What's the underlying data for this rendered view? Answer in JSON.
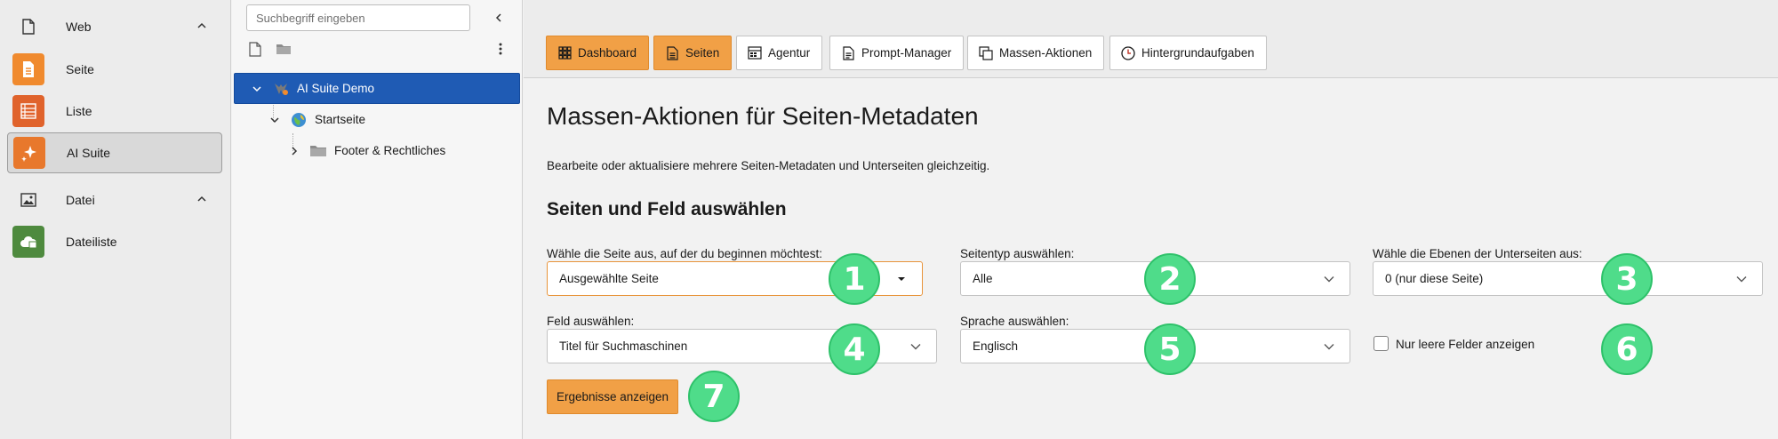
{
  "module_menu": {
    "groups": [
      {
        "label": "Web",
        "icon": "page-outline-icon"
      },
      {
        "label": "Datei",
        "icon": "image-icon"
      }
    ],
    "items": [
      {
        "label": "Seite",
        "icon": "page-module-icon",
        "color": "#f08a2e"
      },
      {
        "label": "Liste",
        "icon": "list-module-icon",
        "color": "#e0632c"
      },
      {
        "label": "AI Suite",
        "icon": "ai-sparkle-icon",
        "color": "#e8782c",
        "active": true
      },
      {
        "label": "Dateiliste",
        "icon": "cloud-files-icon",
        "color": "#4e8a3e"
      }
    ]
  },
  "tree": {
    "search_placeholder": "Suchbegriff eingeben",
    "nodes": [
      {
        "label": "AI Suite Demo",
        "icon": "site-root-icon",
        "selected": true
      },
      {
        "label": "Startseite",
        "icon": "globe-icon"
      },
      {
        "label": "Footer & Rechtliches",
        "icon": "folder-icon"
      }
    ]
  },
  "tabs": [
    {
      "label": "Dashboard",
      "icon": "grid-icon",
      "style": "orange"
    },
    {
      "label": "Seiten",
      "icon": "document-icon",
      "style": "orange"
    },
    {
      "label": "Agentur",
      "icon": "agency-icon",
      "style": "default"
    },
    {
      "label": "Prompt-Manager",
      "icon": "prompt-icon",
      "style": "default"
    },
    {
      "label": "Massen-Aktionen",
      "icon": "copy-icon",
      "style": "default"
    },
    {
      "label": "Hintergrundaufgaben",
      "icon": "clock-icon",
      "style": "default"
    }
  ],
  "main": {
    "title": "Massen-Aktionen für Seiten-Metadaten",
    "description": "Bearbeite oder aktualisiere mehrere Seiten-Metadaten und Unterseiten gleichzeitig.",
    "section_title": "Seiten und Feld auswählen",
    "fields": {
      "start_page": {
        "label": "Wähle die Seite aus, auf der du beginnen möchtest:",
        "value": "Ausgewählte Seite"
      },
      "page_type": {
        "label": "Seitentyp auswählen:",
        "value": "Alle"
      },
      "levels": {
        "label": "Wähle die Ebenen der Unterseiten aus:",
        "value": "0 (nur diese Seite)"
      },
      "field": {
        "label": "Feld auswählen:",
        "value": "Titel für Suchmaschinen"
      },
      "language": {
        "label": "Sprache auswählen:",
        "value": "Englisch"
      },
      "only_empty": {
        "label": "Nur leere Felder anzeigen",
        "checked": false
      }
    },
    "submit_label": "Ergebnisse anzeigen"
  },
  "badges": [
    "1",
    "2",
    "3",
    "4",
    "5",
    "6",
    "7"
  ],
  "colors": {
    "accent": "#f1a046",
    "selected": "#1f5bb4",
    "badge": "#4fdc8a"
  }
}
